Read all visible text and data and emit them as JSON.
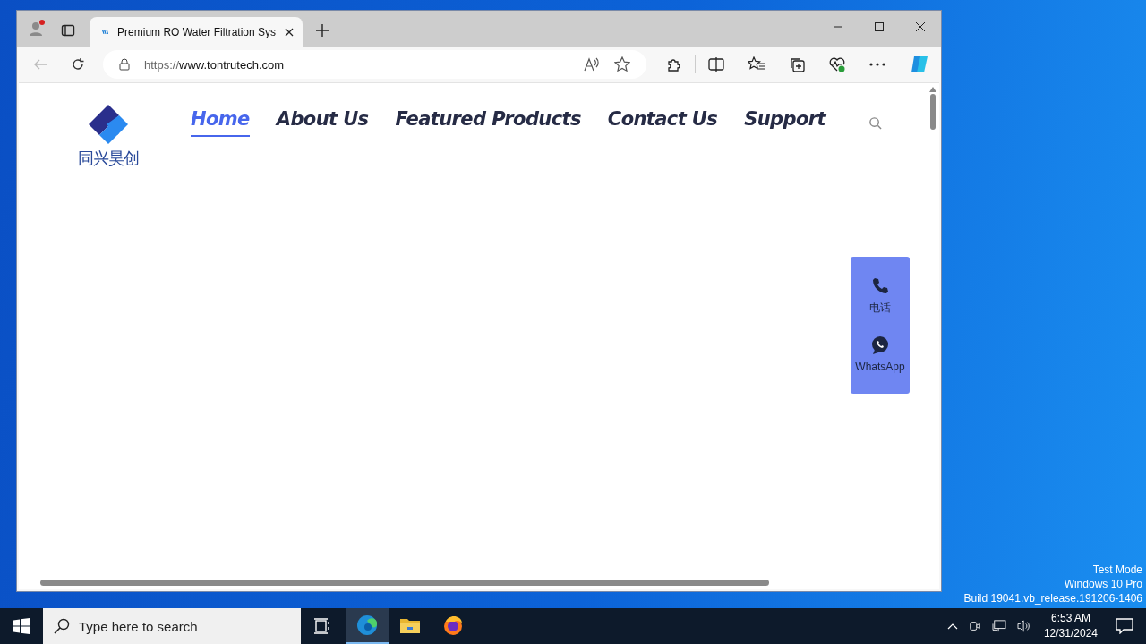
{
  "browser": {
    "tabs": [
      {
        "title": "Premium RO Water Filtration Sys",
        "selected": true
      }
    ],
    "address": {
      "scheme": "https://",
      "host": "www.tontrutech.com"
    }
  },
  "site": {
    "logo_text": "同兴昊创",
    "nav": [
      {
        "label": "Home",
        "selected": true
      },
      {
        "label": "About Us",
        "selected": false
      },
      {
        "label": "Featured Products",
        "selected": false
      },
      {
        "label": "Contact Us",
        "selected": false
      },
      {
        "label": "Support",
        "selected": false
      }
    ]
  },
  "contact_widget": [
    {
      "kind": "phone",
      "label": "电话"
    },
    {
      "kind": "whatsapp",
      "label": "WhatsApp"
    }
  ],
  "system_notice": [
    "Test Mode",
    "Windows 10 Pro",
    "Build 19041.vb_release.191206-1406"
  ],
  "taskbar": {
    "search": {
      "placeholder": "Type here to search"
    },
    "apps": [
      {
        "kind": "edge",
        "selected": true
      },
      {
        "kind": "explorer",
        "selected": false
      },
      {
        "kind": "firefox",
        "selected": false
      }
    ],
    "clock": {
      "time": "6:53 AM",
      "date": "12/31/2024"
    }
  }
}
